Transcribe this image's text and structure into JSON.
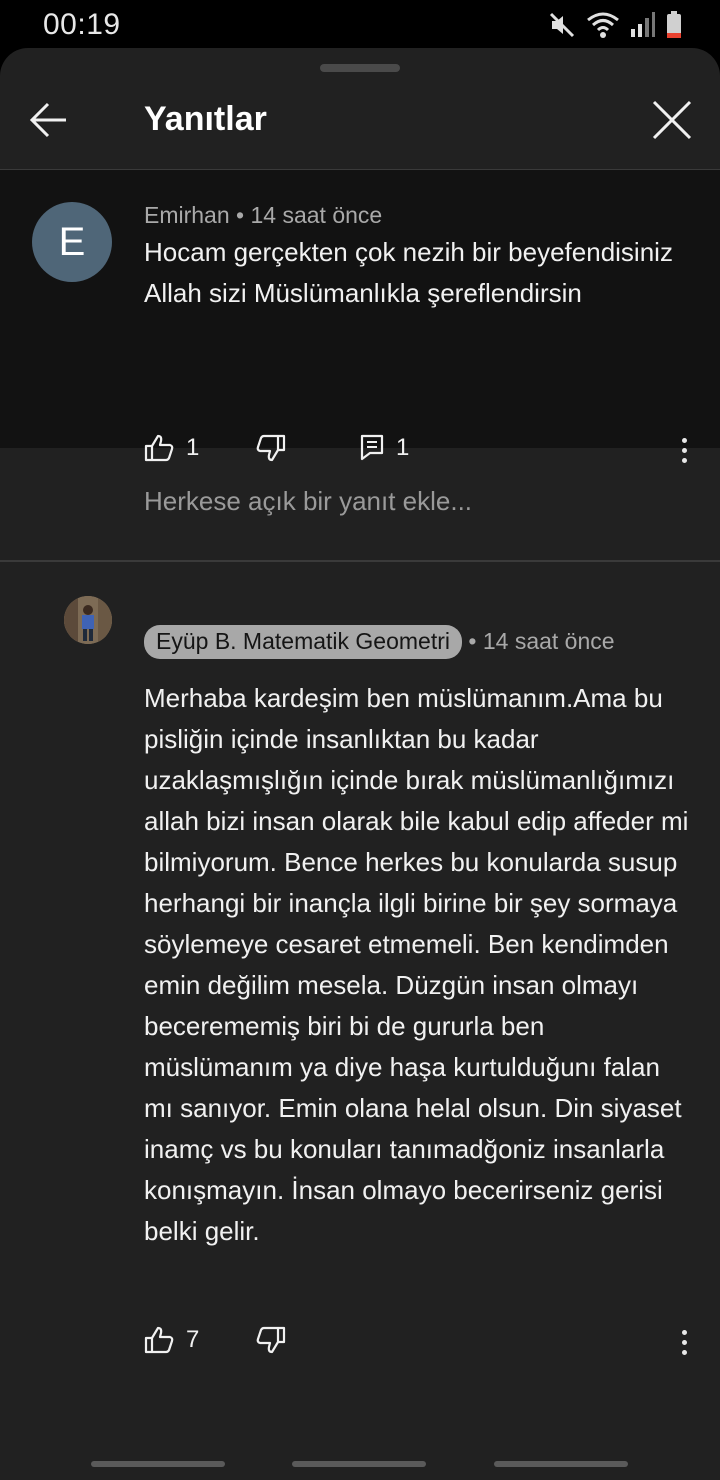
{
  "status_bar": {
    "time": "00:19",
    "icons": [
      "mute-icon",
      "wifi-icon",
      "signal-icon",
      "battery-low-icon"
    ]
  },
  "header": {
    "title": "Yanıtlar"
  },
  "parent_comment": {
    "avatar_letter": "E",
    "avatar_color": "#4f6678",
    "author": "Emirhan",
    "time": "14 saat önce",
    "text": "Hocam gerçekten çok nezih bir beyefendisiniz Allah sizi Müslümanlıkla şereflendirsin",
    "likes": "1",
    "replies": "1"
  },
  "reply_input": {
    "placeholder": "Herkese açık bir yanıt ekle..."
  },
  "reply_comment": {
    "author": "Eyüp B. Matematik Geometri",
    "time": "14 saat önce",
    "text": "Merhaba kardeşim ben müslümanım.Ama bu pisliğin içinde insanlıktan bu kadar uzaklaşmışlığın içinde bırak müslümanlığımızı allah bizi insan olarak bile kabul edip affeder mi bilmiyorum. Bence herkes bu konularda susup herhangi bir inançla ilgli birine bir şey sormaya söylemeye cesaret etmemeli. Ben kendimden emin değilim mesela. Düzgün insan olmayı becerememiş biri bi de gururla ben müslümanım ya diye haşa kurtulduğunı falan mı sanıyor.  Emin olana helal olsun. Din siyaset inamç vs bu konuları tanımadğoniz insanlarla konışmayın. İnsan olmayo becerirseniz gerisi belki gelir.",
    "likes": "7"
  },
  "colors": {
    "sheet_bg": "#212121",
    "parent_bg": "#121212",
    "chip_bg": "#a8a8a8"
  }
}
